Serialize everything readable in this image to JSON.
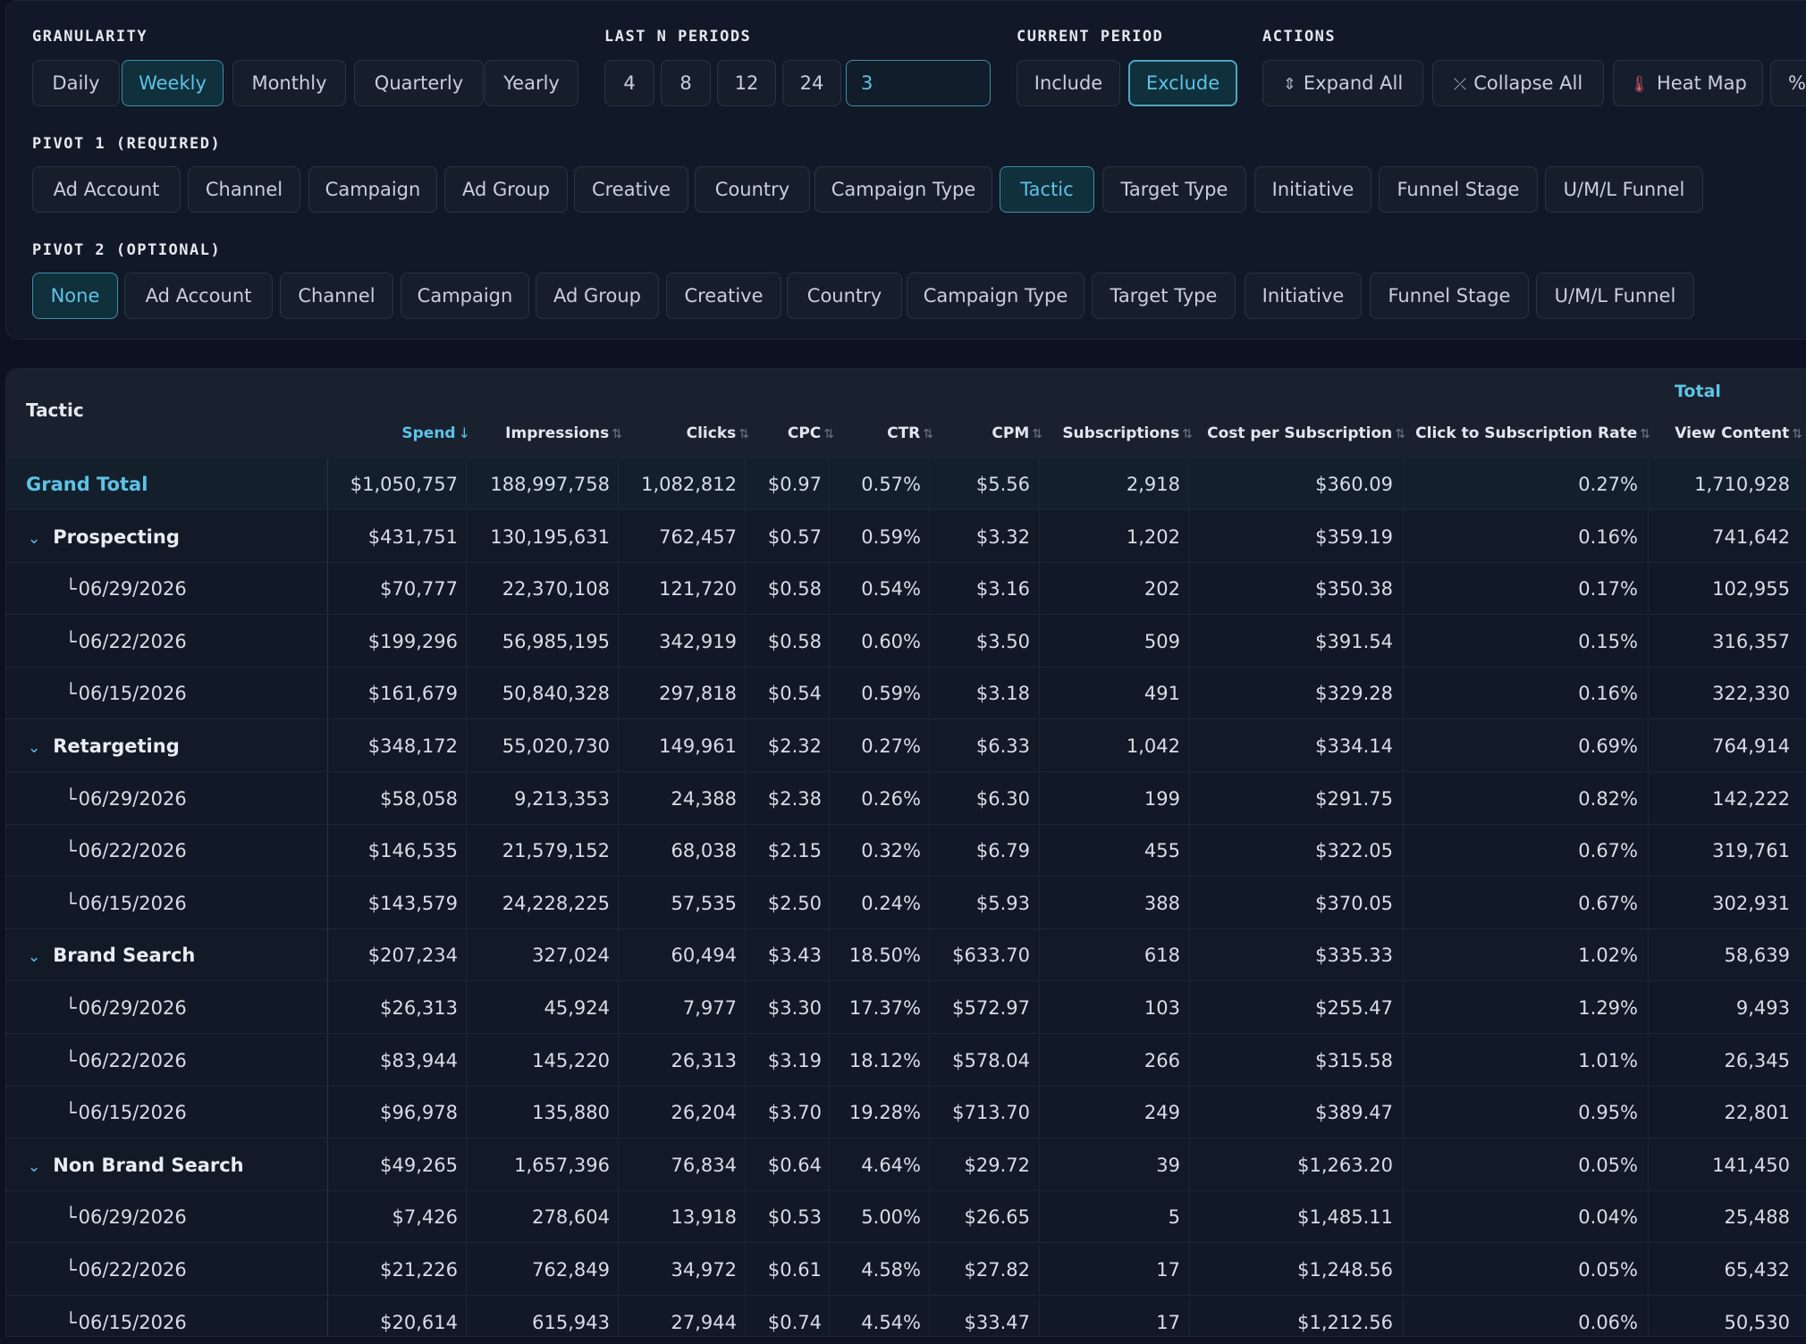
{
  "granularity": {
    "label": "GRANULARITY",
    "options": [
      "Daily",
      "Weekly",
      "Monthly",
      "Quarterly",
      "Yearly"
    ],
    "selected": "Weekly"
  },
  "last_n": {
    "label": "LAST N PERIODS",
    "options": [
      "4",
      "8",
      "12",
      "24"
    ],
    "custom_value": "3"
  },
  "current_period": {
    "label": "CURRENT PERIOD",
    "options": [
      "Include",
      "Exclude"
    ],
    "selected": "Exclude"
  },
  "actions": {
    "label": "ACTIONS",
    "expand_all": "Expand All",
    "collapse_all": "Collapse All",
    "heat_map": "Heat Map",
    "more": "%"
  },
  "pivot1": {
    "label": "PIVOT 1 (REQUIRED)",
    "options": [
      "Ad Account",
      "Channel",
      "Campaign",
      "Ad Group",
      "Creative",
      "Country",
      "Campaign Type",
      "Tactic",
      "Target Type",
      "Initiative",
      "Funnel Stage",
      "U/M/L Funnel"
    ],
    "selected": "Tactic"
  },
  "pivot2": {
    "label": "PIVOT 2 (OPTIONAL)",
    "options": [
      "None",
      "Ad Account",
      "Channel",
      "Campaign",
      "Ad Group",
      "Creative",
      "Country",
      "Campaign Type",
      "Target Type",
      "Initiative",
      "Funnel Stage",
      "U/M/L Funnel"
    ],
    "selected": "None"
  },
  "table": {
    "row_header": "Tactic",
    "group_header": "Total",
    "columns": [
      "Spend",
      "Impressions",
      "Clicks",
      "CPC",
      "CTR",
      "CPM",
      "Subscriptions",
      "Cost per Subscription",
      "Click to Subscription Rate",
      "View Content"
    ],
    "sorted_column": "Spend",
    "rows": [
      {
        "type": "grand",
        "label": "Grand Total",
        "values": [
          "$1,050,757",
          "188,997,758",
          "1,082,812",
          "$0.97",
          "0.57%",
          "$5.56",
          "2,918",
          "$360.09",
          "0.27%",
          "1,710,928"
        ]
      },
      {
        "type": "parent",
        "label": "Prospecting",
        "values": [
          "$431,751",
          "130,195,631",
          "762,457",
          "$0.57",
          "0.59%",
          "$3.32",
          "1,202",
          "$359.19",
          "0.16%",
          "741,642"
        ]
      },
      {
        "type": "child",
        "label": "06/29/2026",
        "values": [
          "$70,777",
          "22,370,108",
          "121,720",
          "$0.58",
          "0.54%",
          "$3.16",
          "202",
          "$350.38",
          "0.17%",
          "102,955"
        ]
      },
      {
        "type": "child",
        "label": "06/22/2026",
        "values": [
          "$199,296",
          "56,985,195",
          "342,919",
          "$0.58",
          "0.60%",
          "$3.50",
          "509",
          "$391.54",
          "0.15%",
          "316,357"
        ]
      },
      {
        "type": "child",
        "label": "06/15/2026",
        "values": [
          "$161,679",
          "50,840,328",
          "297,818",
          "$0.54",
          "0.59%",
          "$3.18",
          "491",
          "$329.28",
          "0.16%",
          "322,330"
        ]
      },
      {
        "type": "parent",
        "label": "Retargeting",
        "values": [
          "$348,172",
          "55,020,730",
          "149,961",
          "$2.32",
          "0.27%",
          "$6.33",
          "1,042",
          "$334.14",
          "0.69%",
          "764,914"
        ]
      },
      {
        "type": "child",
        "label": "06/29/2026",
        "values": [
          "$58,058",
          "9,213,353",
          "24,388",
          "$2.38",
          "0.26%",
          "$6.30",
          "199",
          "$291.75",
          "0.82%",
          "142,222"
        ]
      },
      {
        "type": "child",
        "label": "06/22/2026",
        "values": [
          "$146,535",
          "21,579,152",
          "68,038",
          "$2.15",
          "0.32%",
          "$6.79",
          "455",
          "$322.05",
          "0.67%",
          "319,761"
        ]
      },
      {
        "type": "child",
        "label": "06/15/2026",
        "values": [
          "$143,579",
          "24,228,225",
          "57,535",
          "$2.50",
          "0.24%",
          "$5.93",
          "388",
          "$370.05",
          "0.67%",
          "302,931"
        ]
      },
      {
        "type": "parent",
        "label": "Brand Search",
        "values": [
          "$207,234",
          "327,024",
          "60,494",
          "$3.43",
          "18.50%",
          "$633.70",
          "618",
          "$335.33",
          "1.02%",
          "58,639"
        ]
      },
      {
        "type": "child",
        "label": "06/29/2026",
        "values": [
          "$26,313",
          "45,924",
          "7,977",
          "$3.30",
          "17.37%",
          "$572.97",
          "103",
          "$255.47",
          "1.29%",
          "9,493"
        ]
      },
      {
        "type": "child",
        "label": "06/22/2026",
        "values": [
          "$83,944",
          "145,220",
          "26,313",
          "$3.19",
          "18.12%",
          "$578.04",
          "266",
          "$315.58",
          "1.01%",
          "26,345"
        ]
      },
      {
        "type": "child",
        "label": "06/15/2026",
        "values": [
          "$96,978",
          "135,880",
          "26,204",
          "$3.70",
          "19.28%",
          "$713.70",
          "249",
          "$389.47",
          "0.95%",
          "22,801"
        ]
      },
      {
        "type": "parent",
        "label": "Non Brand Search",
        "values": [
          "$49,265",
          "1,657,396",
          "76,834",
          "$0.64",
          "4.64%",
          "$29.72",
          "39",
          "$1,263.20",
          "0.05%",
          "141,450"
        ]
      },
      {
        "type": "child",
        "label": "06/29/2026",
        "values": [
          "$7,426",
          "278,604",
          "13,918",
          "$0.53",
          "5.00%",
          "$26.65",
          "5",
          "$1,485.11",
          "0.04%",
          "25,488"
        ]
      },
      {
        "type": "child",
        "label": "06/22/2026",
        "values": [
          "$21,226",
          "762,849",
          "34,972",
          "$0.61",
          "4.58%",
          "$27.82",
          "17",
          "$1,248.56",
          "0.05%",
          "65,432"
        ]
      },
      {
        "type": "child",
        "label": "06/15/2026",
        "values": [
          "$20,614",
          "615,943",
          "27,944",
          "$0.74",
          "4.54%",
          "$33.47",
          "17",
          "$1,212.56",
          "0.06%",
          "50,530"
        ]
      }
    ]
  }
}
